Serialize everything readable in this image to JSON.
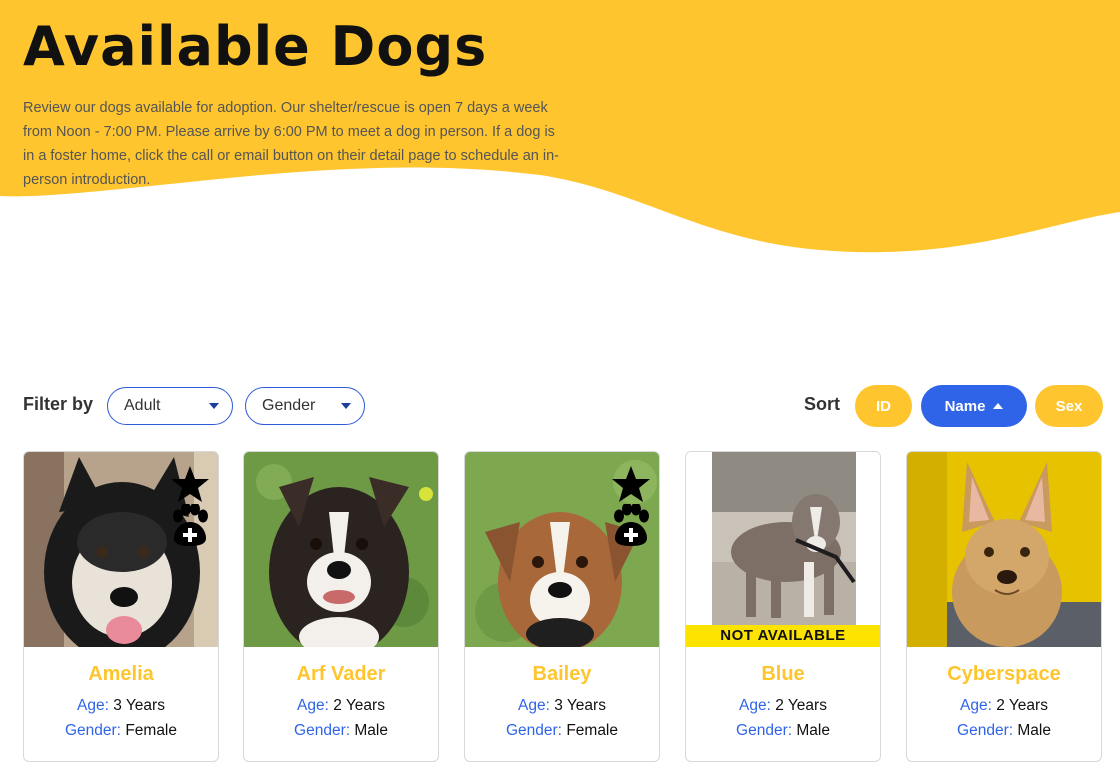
{
  "colors": {
    "brand_yellow": "#fec52e",
    "accent_blue": "#3064e8",
    "label_text": "#333333"
  },
  "hero": {
    "title": "Available Dogs",
    "description": "Review our dogs available for adoption. Our shelter/rescue is open 7 days a week from Noon - 7:00 PM. Please arrive by 6:00 PM to meet a dog in person. If a dog is in a foster home, click the call or email button on their detail page to schedule an in-person introduction."
  },
  "filters": {
    "label": "Filter by",
    "age_value": "Adult",
    "gender_value": "Gender"
  },
  "sort": {
    "label": "Sort",
    "id_label": "ID",
    "name_label": "Name",
    "sex_label": "Sex",
    "active": "Name",
    "direction": "ascending"
  },
  "field_labels": {
    "age": "Age:",
    "gender": "Gender:"
  },
  "dogs": [
    {
      "name": "Amelia",
      "age": "3 Years",
      "gender": "Female",
      "featured_icon": "star-icon",
      "medical_icon": "paw-plus-icon"
    },
    {
      "name": "Arf Vader",
      "age": "2 Years",
      "gender": "Male"
    },
    {
      "name": "Bailey",
      "age": "3 Years",
      "gender": "Female",
      "featured_icon": "star-icon",
      "medical_icon": "paw-plus-icon"
    },
    {
      "name": "Blue",
      "age": "2 Years",
      "gender": "Male",
      "status_banner": "NOT AVAILABLE"
    },
    {
      "name": "Cyberspace",
      "age": "2 Years",
      "gender": "Male"
    }
  ]
}
